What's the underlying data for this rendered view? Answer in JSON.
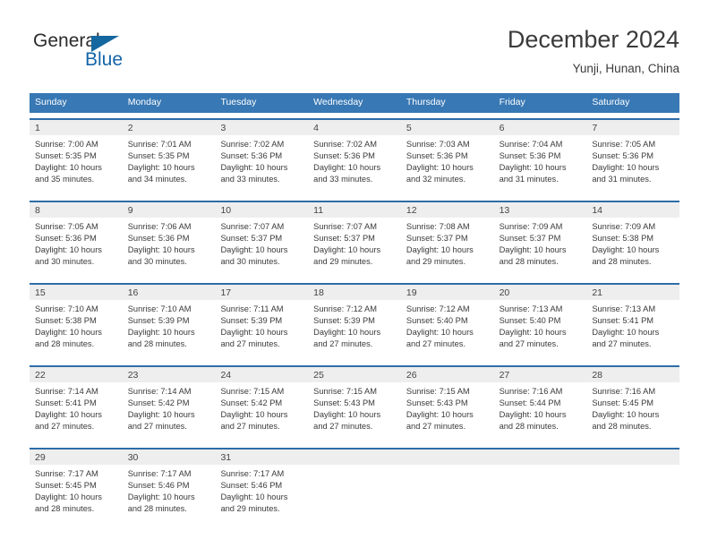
{
  "brand": {
    "name_top": "General",
    "name_bottom": "Blue",
    "accent_color": "#15679f"
  },
  "header": {
    "title": "December 2024",
    "location": "Yunji, Hunan, China"
  },
  "theme": {
    "header_bg": "#3878b4",
    "week_rule": "#2e6da8",
    "daynum_bg": "#eeeeee",
    "text": "#3a3a3a"
  },
  "weekday_headers": [
    "Sunday",
    "Monday",
    "Tuesday",
    "Wednesday",
    "Thursday",
    "Friday",
    "Saturday"
  ],
  "labels": {
    "sunrise_prefix": "Sunrise:",
    "sunset_prefix": "Sunset:",
    "daylight_prefix": "Daylight:"
  },
  "weeks": [
    {
      "days": [
        {
          "num": "1",
          "l1": "Sunrise: 7:00 AM",
          "l2": "Sunset: 5:35 PM",
          "l3": "Daylight: 10 hours",
          "l4": "and 35 minutes."
        },
        {
          "num": "2",
          "l1": "Sunrise: 7:01 AM",
          "l2": "Sunset: 5:35 PM",
          "l3": "Daylight: 10 hours",
          "l4": "and 34 minutes."
        },
        {
          "num": "3",
          "l1": "Sunrise: 7:02 AM",
          "l2": "Sunset: 5:36 PM",
          "l3": "Daylight: 10 hours",
          "l4": "and 33 minutes."
        },
        {
          "num": "4",
          "l1": "Sunrise: 7:02 AM",
          "l2": "Sunset: 5:36 PM",
          "l3": "Daylight: 10 hours",
          "l4": "and 33 minutes."
        },
        {
          "num": "5",
          "l1": "Sunrise: 7:03 AM",
          "l2": "Sunset: 5:36 PM",
          "l3": "Daylight: 10 hours",
          "l4": "and 32 minutes."
        },
        {
          "num": "6",
          "l1": "Sunrise: 7:04 AM",
          "l2": "Sunset: 5:36 PM",
          "l3": "Daylight: 10 hours",
          "l4": "and 31 minutes."
        },
        {
          "num": "7",
          "l1": "Sunrise: 7:05 AM",
          "l2": "Sunset: 5:36 PM",
          "l3": "Daylight: 10 hours",
          "l4": "and 31 minutes."
        }
      ]
    },
    {
      "days": [
        {
          "num": "8",
          "l1": "Sunrise: 7:05 AM",
          "l2": "Sunset: 5:36 PM",
          "l3": "Daylight: 10 hours",
          "l4": "and 30 minutes."
        },
        {
          "num": "9",
          "l1": "Sunrise: 7:06 AM",
          "l2": "Sunset: 5:36 PM",
          "l3": "Daylight: 10 hours",
          "l4": "and 30 minutes."
        },
        {
          "num": "10",
          "l1": "Sunrise: 7:07 AM",
          "l2": "Sunset: 5:37 PM",
          "l3": "Daylight: 10 hours",
          "l4": "and 30 minutes."
        },
        {
          "num": "11",
          "l1": "Sunrise: 7:07 AM",
          "l2": "Sunset: 5:37 PM",
          "l3": "Daylight: 10 hours",
          "l4": "and 29 minutes."
        },
        {
          "num": "12",
          "l1": "Sunrise: 7:08 AM",
          "l2": "Sunset: 5:37 PM",
          "l3": "Daylight: 10 hours",
          "l4": "and 29 minutes."
        },
        {
          "num": "13",
          "l1": "Sunrise: 7:09 AM",
          "l2": "Sunset: 5:37 PM",
          "l3": "Daylight: 10 hours",
          "l4": "and 28 minutes."
        },
        {
          "num": "14",
          "l1": "Sunrise: 7:09 AM",
          "l2": "Sunset: 5:38 PM",
          "l3": "Daylight: 10 hours",
          "l4": "and 28 minutes."
        }
      ]
    },
    {
      "days": [
        {
          "num": "15",
          "l1": "Sunrise: 7:10 AM",
          "l2": "Sunset: 5:38 PM",
          "l3": "Daylight: 10 hours",
          "l4": "and 28 minutes."
        },
        {
          "num": "16",
          "l1": "Sunrise: 7:10 AM",
          "l2": "Sunset: 5:39 PM",
          "l3": "Daylight: 10 hours",
          "l4": "and 28 minutes."
        },
        {
          "num": "17",
          "l1": "Sunrise: 7:11 AM",
          "l2": "Sunset: 5:39 PM",
          "l3": "Daylight: 10 hours",
          "l4": "and 27 minutes."
        },
        {
          "num": "18",
          "l1": "Sunrise: 7:12 AM",
          "l2": "Sunset: 5:39 PM",
          "l3": "Daylight: 10 hours",
          "l4": "and 27 minutes."
        },
        {
          "num": "19",
          "l1": "Sunrise: 7:12 AM",
          "l2": "Sunset: 5:40 PM",
          "l3": "Daylight: 10 hours",
          "l4": "and 27 minutes."
        },
        {
          "num": "20",
          "l1": "Sunrise: 7:13 AM",
          "l2": "Sunset: 5:40 PM",
          "l3": "Daylight: 10 hours",
          "l4": "and 27 minutes."
        },
        {
          "num": "21",
          "l1": "Sunrise: 7:13 AM",
          "l2": "Sunset: 5:41 PM",
          "l3": "Daylight: 10 hours",
          "l4": "and 27 minutes."
        }
      ]
    },
    {
      "days": [
        {
          "num": "22",
          "l1": "Sunrise: 7:14 AM",
          "l2": "Sunset: 5:41 PM",
          "l3": "Daylight: 10 hours",
          "l4": "and 27 minutes."
        },
        {
          "num": "23",
          "l1": "Sunrise: 7:14 AM",
          "l2": "Sunset: 5:42 PM",
          "l3": "Daylight: 10 hours",
          "l4": "and 27 minutes."
        },
        {
          "num": "24",
          "l1": "Sunrise: 7:15 AM",
          "l2": "Sunset: 5:42 PM",
          "l3": "Daylight: 10 hours",
          "l4": "and 27 minutes."
        },
        {
          "num": "25",
          "l1": "Sunrise: 7:15 AM",
          "l2": "Sunset: 5:43 PM",
          "l3": "Daylight: 10 hours",
          "l4": "and 27 minutes."
        },
        {
          "num": "26",
          "l1": "Sunrise: 7:15 AM",
          "l2": "Sunset: 5:43 PM",
          "l3": "Daylight: 10 hours",
          "l4": "and 27 minutes."
        },
        {
          "num": "27",
          "l1": "Sunrise: 7:16 AM",
          "l2": "Sunset: 5:44 PM",
          "l3": "Daylight: 10 hours",
          "l4": "and 28 minutes."
        },
        {
          "num": "28",
          "l1": "Sunrise: 7:16 AM",
          "l2": "Sunset: 5:45 PM",
          "l3": "Daylight: 10 hours",
          "l4": "and 28 minutes."
        }
      ]
    },
    {
      "days": [
        {
          "num": "29",
          "l1": "Sunrise: 7:17 AM",
          "l2": "Sunset: 5:45 PM",
          "l3": "Daylight: 10 hours",
          "l4": "and 28 minutes."
        },
        {
          "num": "30",
          "l1": "Sunrise: 7:17 AM",
          "l2": "Sunset: 5:46 PM",
          "l3": "Daylight: 10 hours",
          "l4": "and 28 minutes."
        },
        {
          "num": "31",
          "l1": "Sunrise: 7:17 AM",
          "l2": "Sunset: 5:46 PM",
          "l3": "Daylight: 10 hours",
          "l4": "and 29 minutes."
        },
        {
          "num": "",
          "l1": "",
          "l2": "",
          "l3": "",
          "l4": ""
        },
        {
          "num": "",
          "l1": "",
          "l2": "",
          "l3": "",
          "l4": ""
        },
        {
          "num": "",
          "l1": "",
          "l2": "",
          "l3": "",
          "l4": ""
        },
        {
          "num": "",
          "l1": "",
          "l2": "",
          "l3": "",
          "l4": ""
        }
      ]
    }
  ]
}
